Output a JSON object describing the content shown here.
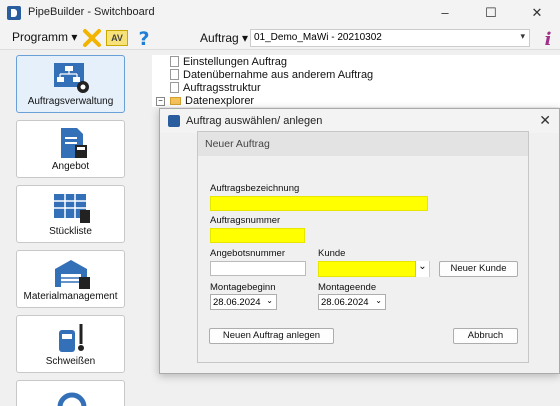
{
  "window": {
    "title": "PipeBuilder - Switchboard",
    "minimize": "–",
    "maximize": "☐",
    "close": "✕"
  },
  "toolbar": {
    "menu_programm": "Programm ▾",
    "av_label": "AV",
    "auftrag_label": "Auftrag ▾",
    "auftrag_value": "01_Demo_MaWi - 20210302",
    "combo_arrow": "▾"
  },
  "sidebar": {
    "items": [
      {
        "label": "Auftragsverwaltung"
      },
      {
        "label": "Angebot"
      },
      {
        "label": "Stückliste"
      },
      {
        "label": "Materialmanagement"
      },
      {
        "label": "Schweißen"
      }
    ]
  },
  "tree": {
    "items": [
      {
        "label": "Einstellungen Auftrag"
      },
      {
        "label": "Datenübernahme aus anderem Auftrag"
      },
      {
        "label": "Auftragsstruktur"
      },
      {
        "label": "Datenexplorer"
      }
    ],
    "collapse_glyph": "−"
  },
  "outer_dialog": {
    "title": "Auftrag auswählen/ anlegen",
    "close": "✕"
  },
  "inner_dialog": {
    "title": "Neuer Auftrag",
    "auftragsbezeichnung_label": "Auftragsbezeichnung",
    "auftragsbezeichnung_value": "",
    "auftragsnummer_label": "Auftragsnummer",
    "auftragsnummer_value": "",
    "angebotsnummer_label": "Angebotsnummer",
    "angebotsnummer_value": "",
    "kunde_label": "Kunde",
    "kunde_value": "",
    "kunde_arrow": "⌄",
    "neuer_kunde_button": "Neuer Kunde",
    "montagebeginn_label": "Montagebeginn",
    "montagebeginn_value": "28.06.2024",
    "montageende_label": "Montageende",
    "montageende_value": "28.06.2024",
    "date_arrow": "⌄",
    "neuer_auftrag_button": "Neuen Auftrag anlegen",
    "abbruch_button": "Abbruch"
  },
  "colors": {
    "required_field": "#ffff00",
    "accent": "#2a5d9e",
    "active_sidebar": "#e6f0fb"
  }
}
